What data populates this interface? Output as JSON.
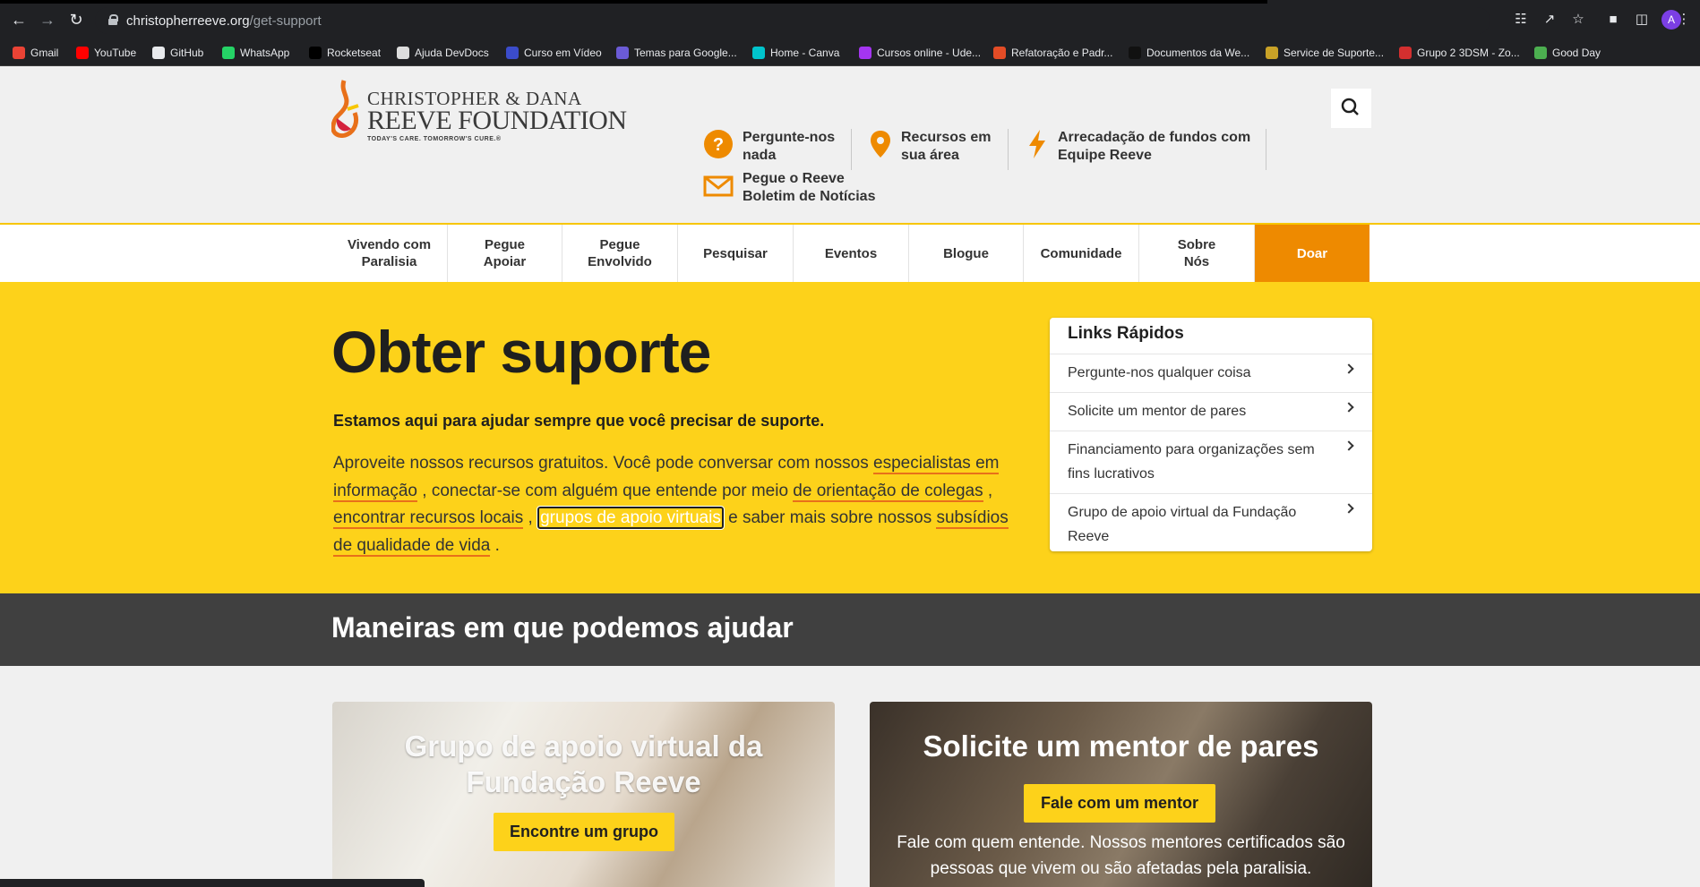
{
  "browser": {
    "url_host": "christopherreeve.org",
    "url_path": "/get-support",
    "profile_initial": "A",
    "bookmarks": [
      {
        "label": "Gmail",
        "icon": "gmail-icon",
        "color": "#ea4335"
      },
      {
        "label": "YouTube",
        "icon": "youtube-icon",
        "color": "#ff0000"
      },
      {
        "label": "GitHub",
        "icon": "github-icon",
        "color": "#e8eaed"
      },
      {
        "label": "WhatsApp",
        "icon": "whatsapp-icon",
        "color": "#25d366"
      },
      {
        "label": "Rocketseat",
        "icon": "rocketseat-icon",
        "color": "#000000"
      },
      {
        "label": "Ajuda DevDocs",
        "icon": "devdocs-icon",
        "color": "#dddddd"
      },
      {
        "label": "Curso em Vídeo",
        "icon": "cursoemvideo-icon",
        "color": "#3b4cca"
      },
      {
        "label": "Temas para Google...",
        "icon": "puzzle-icon",
        "color": "#6b5bd6"
      },
      {
        "label": "Home - Canva",
        "icon": "canva-icon",
        "color": "#00c4cc"
      },
      {
        "label": "Cursos online - Ude...",
        "icon": "udemy-icon",
        "color": "#a435f0"
      },
      {
        "label": "Refatoração e Padr...",
        "icon": "refactoring-icon",
        "color": "#e34c26"
      },
      {
        "label": "Documentos da We...",
        "icon": "mdn-icon",
        "color": "#111111"
      },
      {
        "label": "Service de Suporte...",
        "icon": "support-icon",
        "color": "#c9a227"
      },
      {
        "label": "Grupo 2 3DSM - Zo...",
        "icon": "zoho-icon",
        "color": "#d32f2f"
      },
      {
        "label": "Good Day",
        "icon": "goodday-icon",
        "color": "#4caf50"
      }
    ]
  },
  "logo": {
    "line1": "CHRISTOPHER & DANA",
    "line2": "REEVE FOUNDATION",
    "tagline": "TODAY'S CARE. TOMORROW'S CURE.®"
  },
  "utility_links": {
    "ask": "Pergunte-nos nada",
    "ask_l1": "Pergunte-nos",
    "ask_l2": "nada",
    "resources_l1": "Recursos em",
    "resources_l2": "sua área",
    "fundraise_l1": "Arrecadação de fundos com",
    "fundraise_l2": "Equipe Reeve",
    "newsletter_l1": "Pegue o Reeve",
    "newsletter_l2": "Boletim de Notícias"
  },
  "nav": {
    "living_l1": "Vivendo com",
    "living_l2": "Paralisia",
    "support_l1": "Pegue",
    "support_l2": "Apoiar",
    "involved_l1": "Pegue",
    "involved_l2": "Envolvido",
    "research": "Pesquisar",
    "events": "Eventos",
    "blog": "Blogue",
    "community": "Comunidade",
    "about_l1": "Sobre",
    "about_l2": "Nós",
    "donate": "Doar"
  },
  "hero": {
    "title": "Obter suporte",
    "lead": "Estamos aqui para ajudar sempre que você precisar de suporte.",
    "t1": "Aproveite nossos recursos gratuitos. Você pode conversar com nossos ",
    "link1": "especialistas em informação",
    "t2": " , conectar-se com alguém que entende por meio ",
    "link2": "de orientação de colegas",
    "t3": " , ",
    "link3": "encontrar recursos locais",
    "t4": " , ",
    "link4": "grupos de apoio virtuais",
    "t5": " e saber mais sobre nossos ",
    "link5": "subsídios de qualidade de vida",
    "t6": " ."
  },
  "quick_links": {
    "title": "Links Rápidos",
    "items": [
      "Pergunte-nos qualquer coisa",
      "Solicite um mentor de pares",
      "Financiamento para organizações sem fins lucrativos",
      "Grupo de apoio virtual da Fundação Reeve"
    ]
  },
  "section": {
    "title": "Maneiras em que podemos ajudar"
  },
  "cards": {
    "left_title": "Grupo de apoio virtual da Fundação Reeve",
    "left_button": "Encontre um grupo",
    "right_title": "Solicite um mentor de pares",
    "right_button": "Fale com um mentor",
    "right_text": "Fale com quem entende. Nossos mentores certificados são pessoas que vivem ou são afetadas pela paralisia."
  },
  "colors": {
    "brand_yellow": "#fdd21a",
    "brand_orange": "#ee8a00",
    "dark_band": "#404040"
  }
}
